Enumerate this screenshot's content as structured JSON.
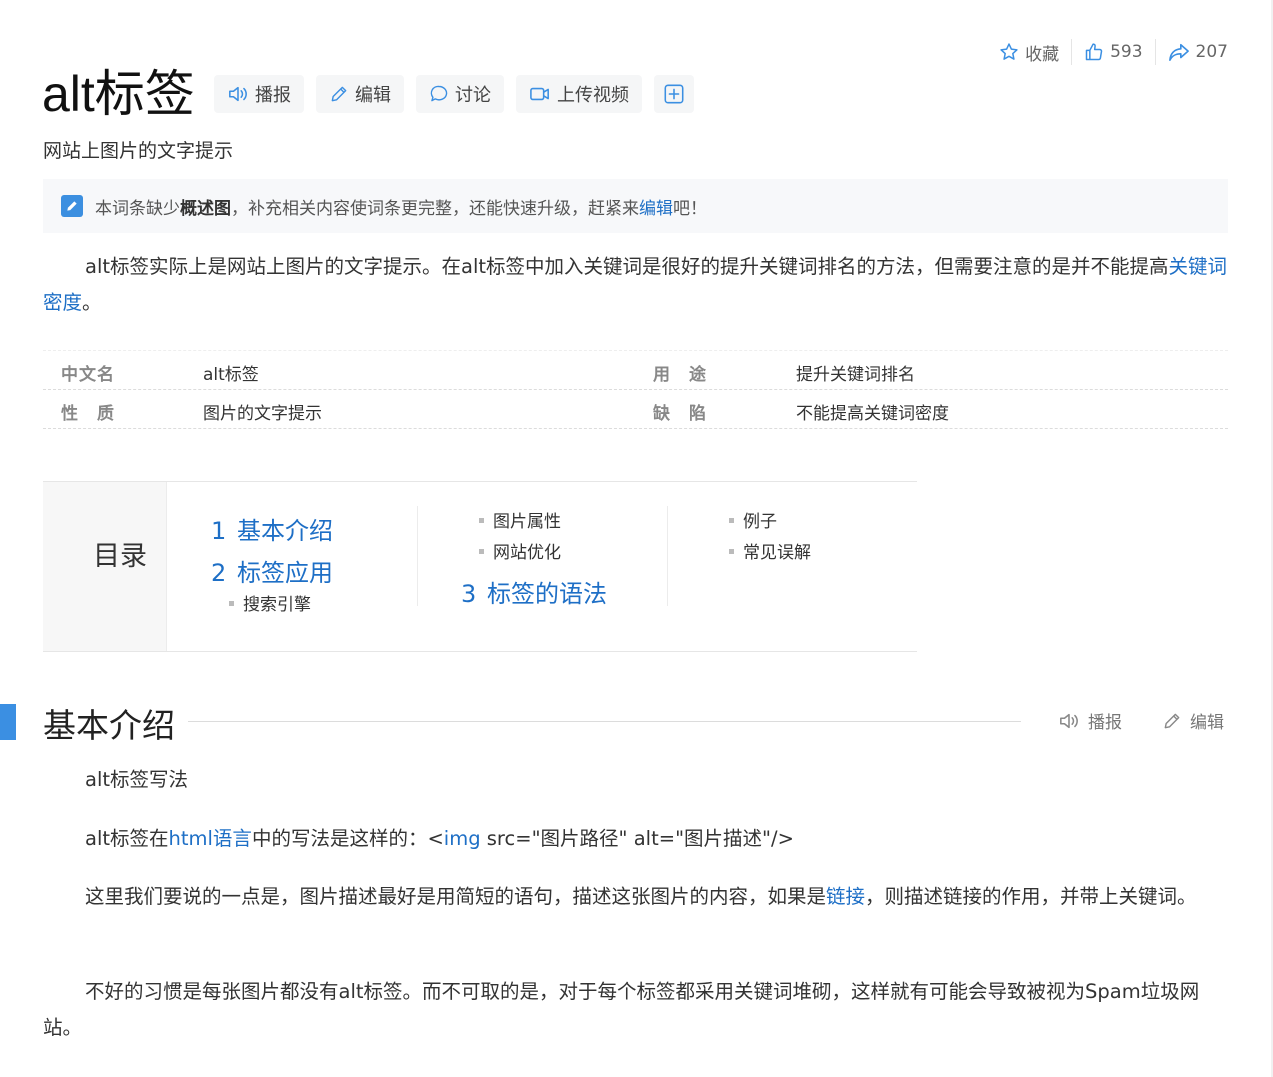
{
  "actions": {
    "favorite_label": "收藏",
    "like_count": "593",
    "share_count": "207"
  },
  "title": "alt标签",
  "title_buttons": {
    "broadcast": "播报",
    "edit": "编辑",
    "discuss": "讨论",
    "upload_video": "上传视频"
  },
  "subtitle": "网站上图片的文字提示",
  "notice": {
    "prefix": "本词条缺少",
    "bold": "概述图",
    "middle": "，补充相关内容使词条更完整，还能快速升级，赶紧来",
    "link": "编辑",
    "suffix": "吧！"
  },
  "summary": {
    "text": "alt标签实际上是网站上图片的文字提示。在alt标签中加入关键词是很好的提升关键词排名的方法，但需要注意的是并不能提高",
    "link": "关键词密度",
    "end": "。"
  },
  "basic_info": [
    {
      "label": "中文名",
      "value": "alt标签",
      "label2": "用　途",
      "value2": "提升关键词排名"
    },
    {
      "label": "性　质",
      "value": "图片的文字提示",
      "label2": "缺　陷",
      "value2": "不能提高关键词密度"
    }
  ],
  "catalog": {
    "title": "目录",
    "items": [
      {
        "num": "1",
        "label": "基本介绍"
      },
      {
        "num": "2",
        "label": "标签应用"
      },
      {
        "num": "3",
        "label": "标签的语法"
      }
    ],
    "subitems": [
      "搜索引擎",
      "图片属性",
      "网站优化",
      "例子",
      "常见误解"
    ]
  },
  "section": {
    "title": "基本介绍",
    "broadcast": "播报",
    "edit": "编辑"
  },
  "body": {
    "p1": "alt标签写法",
    "p2_pre": "alt标签在",
    "p2_link": "html语言",
    "p2_mid": "中的写法是这样的：<",
    "p2_link2": "img",
    "p2_post": " src=\"图片路径\" alt=\"图片描述\"/>",
    "p3_pre": "这里我们要说的一点是，图片描述最好是用简短的语句，描述这张图片的内容，如果是",
    "p3_link": "链接",
    "p3_post": "，则描述链接的作用，并带上关键词。",
    "p4": "不好的习惯是每张图片都没有alt标签。而不可取的是，对于每个标签都采用关键词堆砌，这样就有可能会导致被视为Spam垃圾网站。"
  },
  "colors": {
    "accent": "#3b8fe2",
    "link": "#1e6fc6"
  }
}
